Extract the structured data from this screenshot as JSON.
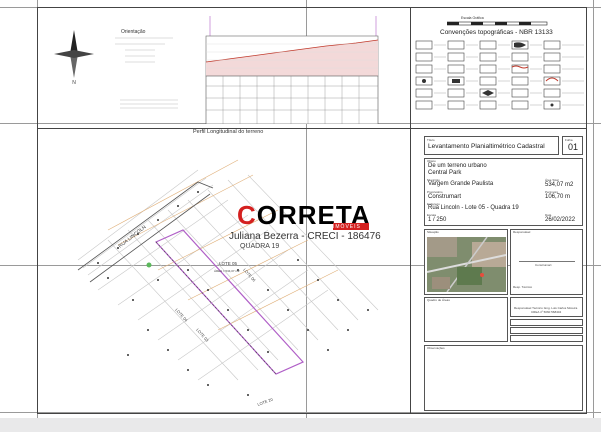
{
  "orientation": {
    "title": "Orientação"
  },
  "north_arrow": {
    "label": "N"
  },
  "profile": {
    "title": "Perfil Longitudinal do terreno"
  },
  "conventions": {
    "title": "Convenções topográficas - NBR 13133",
    "scale_label": "Escala Gráfica"
  },
  "titleblock": {
    "title_label": "Título",
    "title": "Levantamento Planialtimétrico Cadastral",
    "sheet_label": "Folha",
    "sheet": "01",
    "object_label": "Objeto",
    "object_line1": "De um terreno urbano",
    "object_line2": "Central Park",
    "municipality_label": "Município",
    "municipality": "Vargem Grande Paulista",
    "area_label": "Área Total",
    "area": "534,07 m2",
    "owner_label": "Proprietário",
    "owner": "Construmart",
    "perimeter_label": "Perímetro",
    "perimeter": "106,70 m",
    "address_label": "Endereço",
    "address": "Rua Lincoln - Lote 05 - Quadra 19",
    "scale_label": "Escala",
    "scale": "1 / 250",
    "date_label": "Data",
    "date": "26/02/2022",
    "location_label": "Situação",
    "responsible_label": "Responsável",
    "responsible_sig": "Construmart",
    "resp_tech_label": "Resp. Técnico",
    "notes_label": "Quadro de Áreas",
    "resp_tech_name": "Responsável Técnico: Eng. Luis Carlos Moreira",
    "resp_tech_crea": "CREA nº 5060 568404",
    "remarks_label": "Observações"
  },
  "watermark": {
    "brand_prefix": "C",
    "brand_rest": "ORRETA",
    "brand_sub": "IMÓVEIS",
    "agent": "Juliana Bezerra - CRECI - 186476",
    "block": "QUADRA 19"
  },
  "map": {
    "street": "RUA LINCOLN",
    "lot": "LOTE 05",
    "lot_area": "ÁREA = 534,07 m2",
    "lot6": "LOTE 06",
    "lot4": "LOTE 04",
    "lot3": "LOTE 03",
    "lot2": "LOTE 20"
  },
  "colors": {
    "brand_red": "#d4201f",
    "lot_outline": "#b05fc7",
    "profile_fill": "#f3d9d9",
    "profile_line": "#c0392b"
  }
}
